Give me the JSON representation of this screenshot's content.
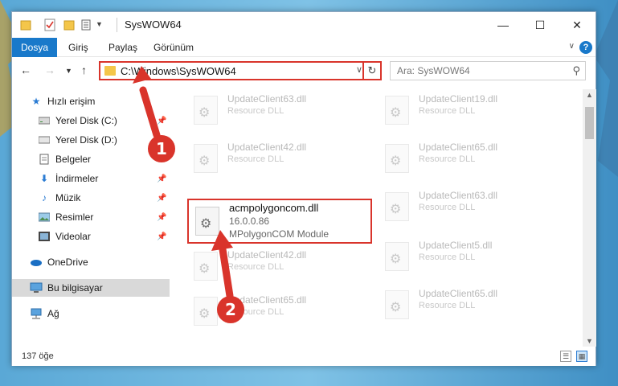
{
  "window": {
    "title": "SysWOW64",
    "controls": {
      "minimize": "—",
      "maximize": "☐",
      "close": "✕"
    }
  },
  "ribbon": {
    "file_tab": "Dosya",
    "tabs": [
      "Giriş",
      "Paylaş",
      "Görünüm"
    ],
    "help": "?"
  },
  "address": {
    "path": "C:\\Windows\\SysWOW64",
    "search_placeholder": "Ara: SysWOW64"
  },
  "sidebar": {
    "items": [
      {
        "label": "Hızlı erişim",
        "icon": "star-icon"
      },
      {
        "label": "Yerel Disk (C:)",
        "icon": "drive-icon"
      },
      {
        "label": "Yerel Disk (D:)",
        "icon": "drive-icon"
      },
      {
        "label": "Belgeler",
        "icon": "documents-icon"
      },
      {
        "label": "İndirmeler",
        "icon": "download-icon"
      },
      {
        "label": "Müzik",
        "icon": "music-icon"
      },
      {
        "label": "Resimler",
        "icon": "pictures-icon"
      },
      {
        "label": "Videolar",
        "icon": "video-icon"
      },
      {
        "label": "OneDrive",
        "icon": "cloud-icon"
      },
      {
        "label": "Bu bilgisayar",
        "icon": "computer-icon"
      },
      {
        "label": "Ağ",
        "icon": "network-icon"
      }
    ]
  },
  "files": {
    "left": [
      {
        "name": "UpdateClient63.dll",
        "desc": "Resource DLL"
      },
      {
        "name": "UpdateClient42.dll",
        "desc": "Resource DLL"
      },
      {
        "name": "UpdateClient42.dll",
        "desc": "Resource DLL"
      },
      {
        "name": "UpdateClient65.dll",
        "desc": "Resource DLL"
      }
    ],
    "right": [
      {
        "name": "UpdateClient19.dll",
        "desc": "Resource DLL"
      },
      {
        "name": "UpdateClient65.dll",
        "desc": "Resource DLL"
      },
      {
        "name": "UpdateClient63.dll",
        "desc": "Resource DLL"
      },
      {
        "name": "UpdateClient5.dll",
        "desc": "Resource DLL"
      },
      {
        "name": "UpdateClient65.dll",
        "desc": "Resource DLL"
      }
    ],
    "selected": {
      "name": "acmpolygoncom.dll",
      "version": "16.0.0.86",
      "desc": "MPolygonCOM Module"
    }
  },
  "status": {
    "count": "137 öğe"
  },
  "callouts": {
    "one": "1",
    "two": "2"
  },
  "colors": {
    "highlight": "#d9342b",
    "accent": "#1979ca"
  }
}
